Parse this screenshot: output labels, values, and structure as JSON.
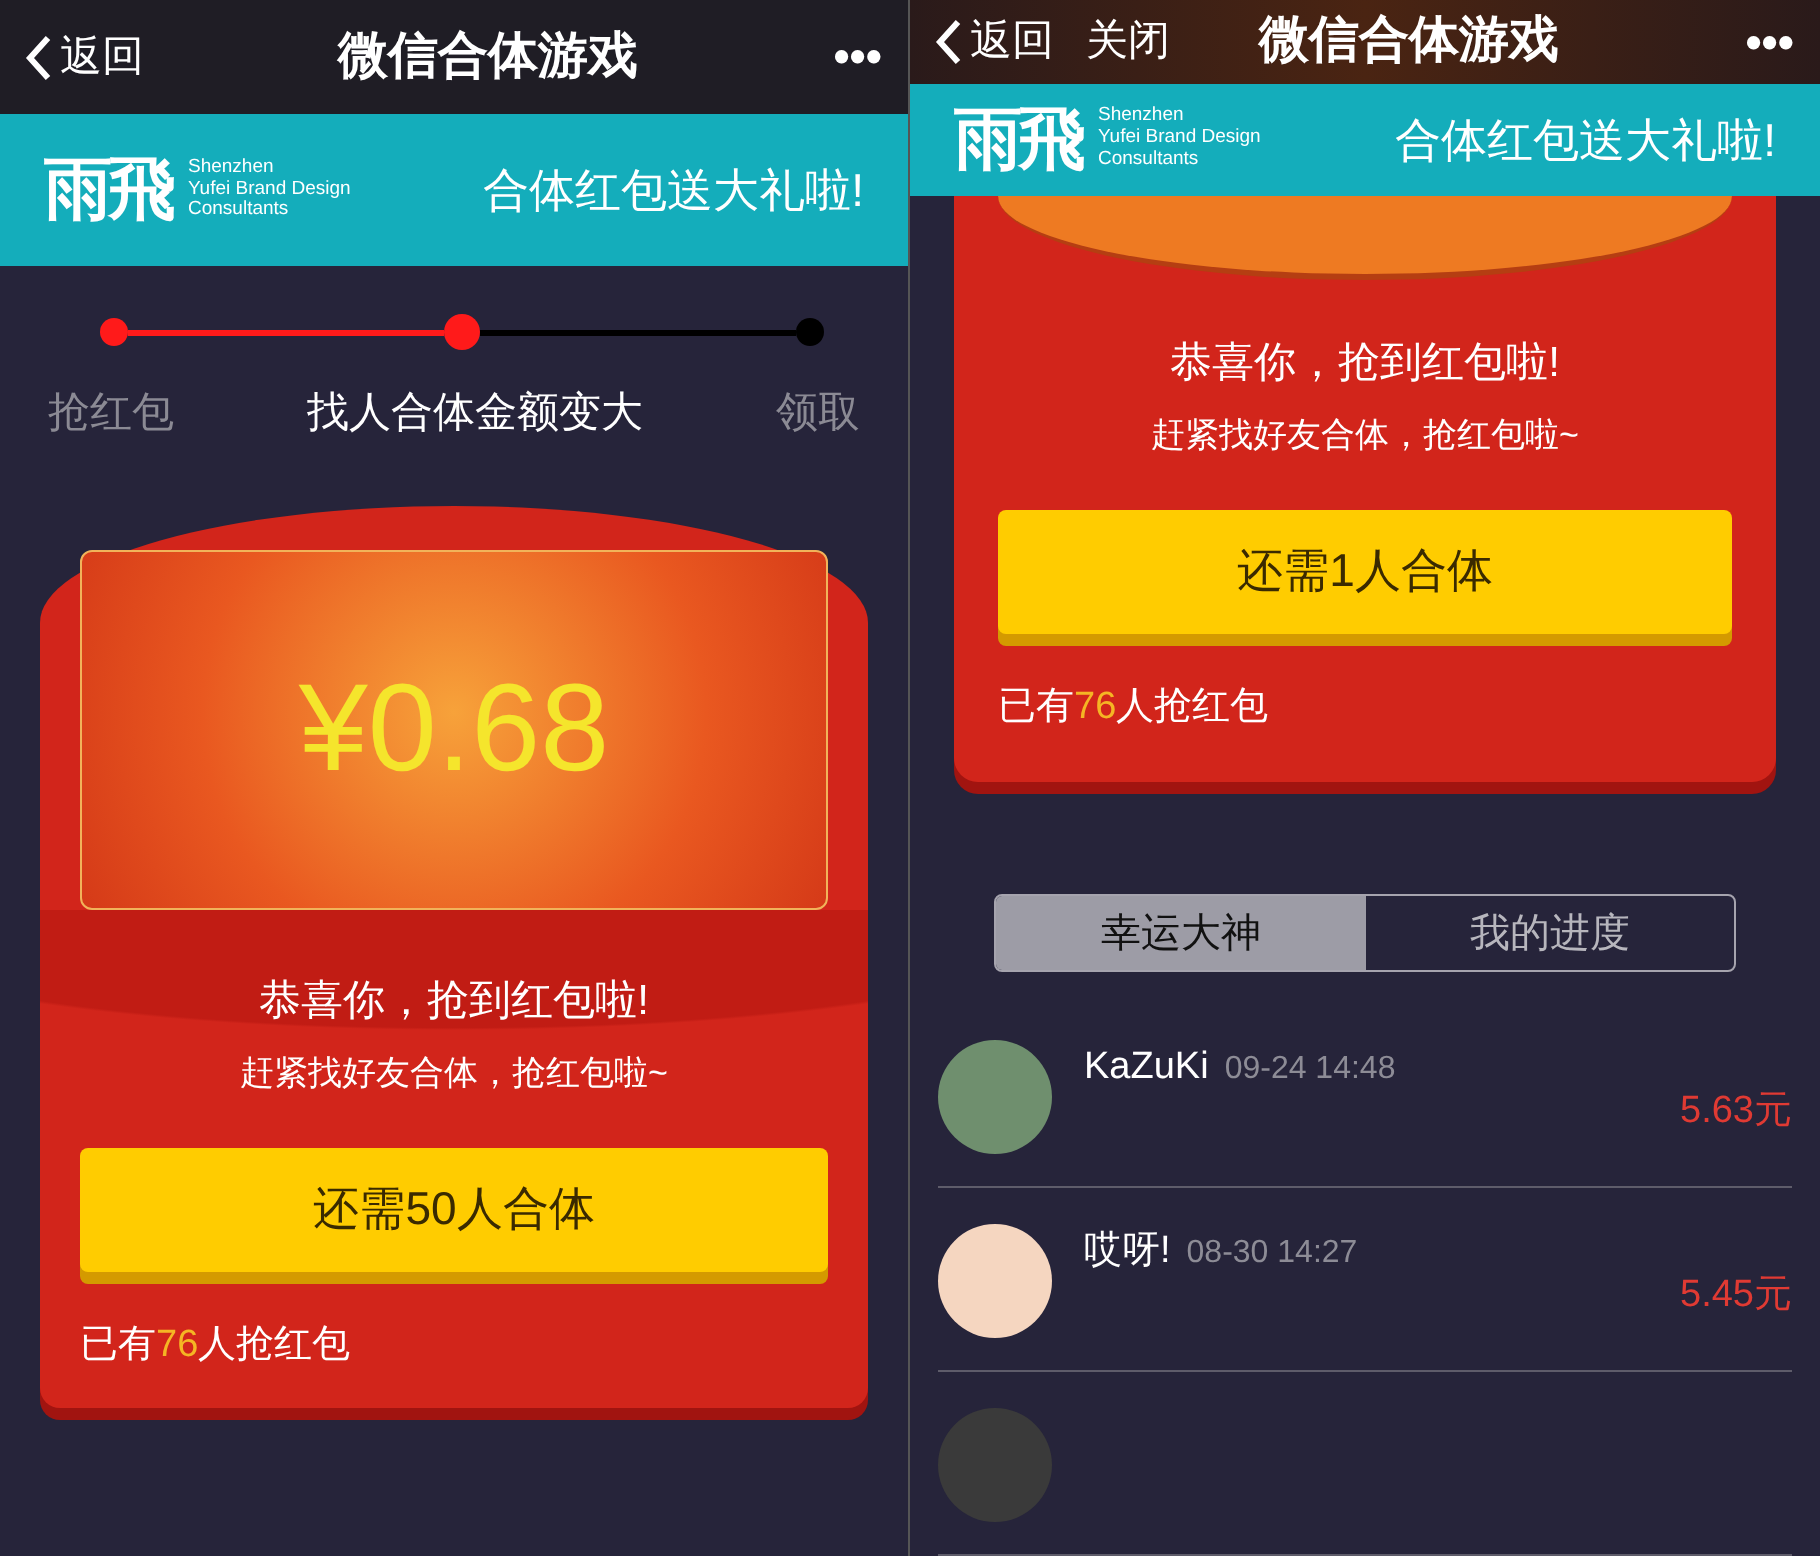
{
  "screens": [
    {
      "nav": {
        "back": "返回",
        "title": "微信合体游戏",
        "more": "•••"
      },
      "banner": {
        "logo_mark": "雨飛",
        "logo_lines": [
          "Shenzhen",
          "Yufei Brand Design",
          "Consultants"
        ],
        "slogan": "合体红包送大礼啦!"
      },
      "steps": [
        {
          "label": "抢红包",
          "reached": true,
          "selected": false
        },
        {
          "label": "找人合体金额变大",
          "reached": true,
          "selected": true
        },
        {
          "label": "领取",
          "reached": false,
          "selected": false
        }
      ],
      "envelope": {
        "kind": "closed",
        "amount": "¥0.68",
        "congrats": "恭喜你，抢到红包啦!",
        "hint": "赶紧找好友合体，抢红包啦~",
        "button": "还需50人合体",
        "count": {
          "prefix": "已有",
          "number": "76",
          "suffix": "人抢红包"
        }
      }
    },
    {
      "nav": {
        "back": "返回",
        "close": "关闭",
        "title": "微信合体游戏",
        "more": "•••"
      },
      "banner": {
        "logo_mark": "雨飛",
        "logo_lines": [
          "Shenzhen",
          "Yufei Brand Design",
          "Consultants"
        ],
        "slogan": "合体红包送大礼啦!"
      },
      "envelope": {
        "kind": "open",
        "congrats": "恭喜你，抢到红包啦!",
        "hint": "赶紧找好友合体，抢红包啦~",
        "button": "还需1人合体",
        "count": {
          "prefix": "已有",
          "number": "76",
          "suffix": "人抢红包"
        }
      },
      "tabs": [
        {
          "label": "幸运大神",
          "selected": true
        },
        {
          "label": "我的进度",
          "selected": false
        }
      ],
      "list": [
        {
          "name": "KaZuKi",
          "time": "09-24 14:48",
          "amount": "5.63元",
          "color": "#6f8f6e"
        },
        {
          "name": "哎呀!",
          "time": "08-30 14:27",
          "amount": "5.45元",
          "color": "#f5d6c0"
        },
        {
          "color": "#3a3a3a"
        }
      ]
    }
  ]
}
